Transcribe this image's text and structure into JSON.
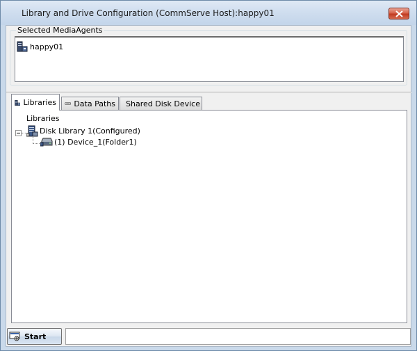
{
  "window": {
    "title": "Library and Drive Configuration (CommServe Host):happy01"
  },
  "media_agents": {
    "group_label": "Selected MediaAgents",
    "items": [
      {
        "label": "happy01",
        "icon": "media-agent-icon"
      }
    ]
  },
  "tabs": [
    {
      "label": "Libraries",
      "icon": "library-icon",
      "active": true
    },
    {
      "label": "Data Paths",
      "icon": "data-path-icon",
      "active": false
    },
    {
      "label": "Shared Disk Device",
      "icon": "shared-disk-icon",
      "active": false
    }
  ],
  "tree": {
    "root_label": "Libraries",
    "library": {
      "label": "Disk Library 1(Configured)",
      "icon": "disk-library-icon",
      "expanded": true,
      "children": [
        {
          "label": "(1) Device_1(Folder1)",
          "icon": "disk-device-icon"
        }
      ]
    }
  },
  "statusbar": {
    "start_label": "Start",
    "status_text": ""
  },
  "colors": {
    "titlebar": "#cddcee",
    "close_button": "#c0381f",
    "client_bg": "#f0f0f0"
  }
}
